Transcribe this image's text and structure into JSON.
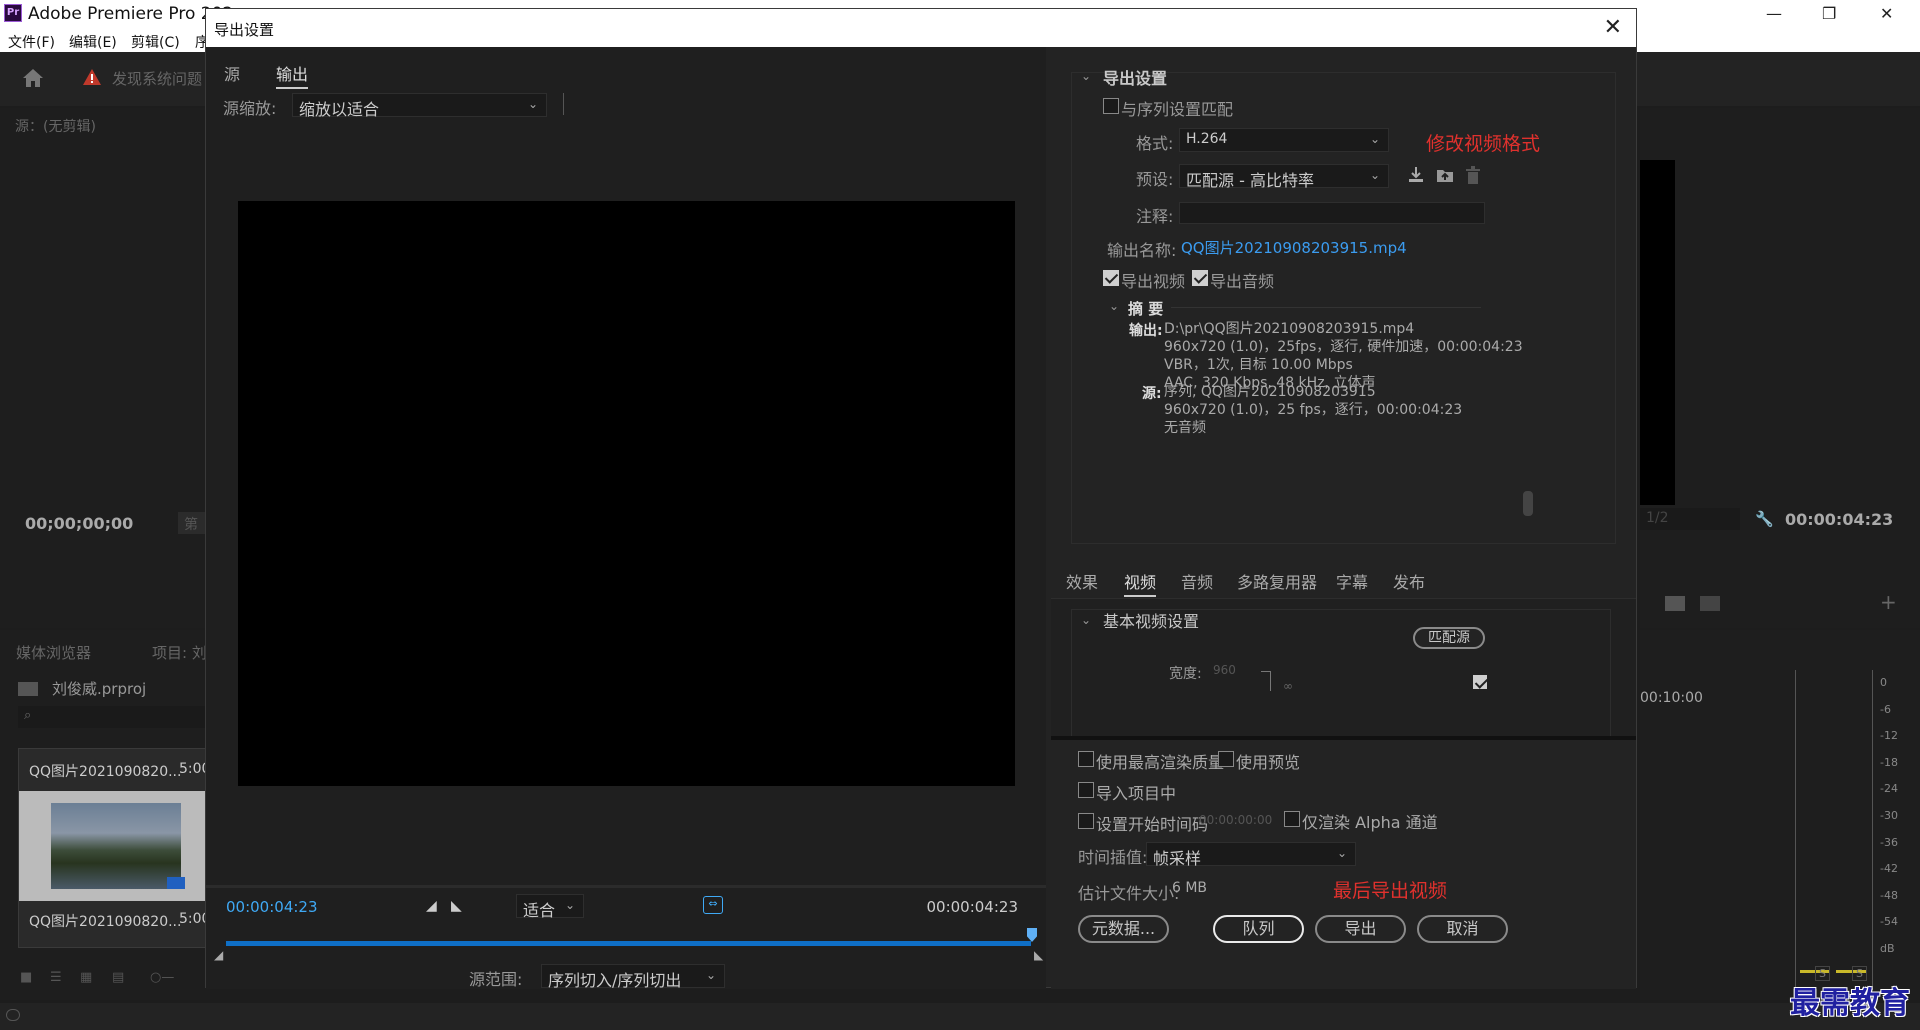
{
  "app": {
    "title": "Adobe Premiere Pro 202",
    "menu": [
      "文件(F)",
      "编辑(E)",
      "剪辑(C)",
      "序"
    ],
    "toolbar_warning": "发现系统问题"
  },
  "source_panel": {
    "title": "源：(无剪辑)",
    "timecode": "00;00;00;00",
    "badge": "第"
  },
  "project_panel": {
    "tabs": [
      "媒体浏览器",
      "项目: 刘"
    ],
    "project_name": "刘俊威.prproj",
    "clip_name": "QQ图片2021090820...",
    "clip_duration": "5:00",
    "clip_name_2": "QQ图片2021090820...",
    "clip_duration_2": "5:00"
  },
  "right_panel": {
    "fraction": "1/2",
    "timecode": "00:00:04:23",
    "timeline_time": "00:10:00",
    "meter_labels": [
      "0",
      "-6",
      "-12",
      "-18",
      "-24",
      "-30",
      "-36",
      "-42",
      "-48",
      "-54",
      "dB"
    ],
    "solo_labels": [
      "S",
      "S"
    ]
  },
  "dialog": {
    "title": "导出设置",
    "close": "✕",
    "preview": {
      "tabs": [
        "源",
        "输出"
      ],
      "active_tab": "输出",
      "zoom_label": "源缩放:",
      "zoom_value": "缩放以适合",
      "tc_in": "00:00:04:23",
      "tc_out": "00:00:04:23",
      "fit_value": "适合",
      "range_label": "源范围:",
      "range_value": "序列切入/序列切出"
    },
    "export_settings": {
      "section_title": "导出设置",
      "match_sequence_label": "与序列设置匹配",
      "match_sequence_checked": false,
      "format_label": "格式:",
      "format_value": "H.264",
      "format_note": "修改视频格式",
      "preset_label": "预设:",
      "preset_value": "匹配源 - 高比特率",
      "comments_label": "注释:",
      "comments_value": "",
      "output_name_label": "输出名称:",
      "output_name_value": "QQ图片20210908203915.mp4",
      "export_video_label": "导出视频",
      "export_video_checked": true,
      "export_audio_label": "导出音频",
      "export_audio_checked": true,
      "summary": {
        "title": "摘 要",
        "output_label": "输出:",
        "output_lines": [
          "D:\\pr\\QQ图片20210908203915.mp4",
          "960x720 (1.0)，25fps，逐行, 硬件加速，00:00:04:23",
          "VBR，1次, 目标 10.00 Mbps",
          "AAC, 320 Kbps, 48 kHz, 立体声"
        ],
        "source_label": "源:",
        "source_lines": [
          "序列, QQ图片20210908203915",
          "960x720 (1.0)，25 fps，逐行，00:00:04:23",
          "无音频"
        ]
      }
    },
    "sub_tabs": [
      "效果",
      "视频",
      "音频",
      "多路复用器",
      "字幕",
      "发布"
    ],
    "active_sub_tab": "视频",
    "video": {
      "section_title": "基本视频设置",
      "match_source_button": "匹配源",
      "width_label": "宽度:",
      "width_value": "960"
    },
    "options": {
      "max_render_quality": "使用最高渲染质量",
      "use_previews": "使用预览",
      "import_into_project": "导入项目中",
      "set_start_timecode": "设置开始时间码",
      "start_timecode_value": "00:00:00:00",
      "render_alpha_only": "仅渲染 Alpha 通道",
      "time_interpolation_label": "时间插值:",
      "time_interpolation_value": "帧采样",
      "file_size_label": "估计文件大小:",
      "file_size_value": "6 MB",
      "final_note": "最后导出视频"
    },
    "buttons": {
      "metadata": "元数据...",
      "queue": "队列",
      "export": "导出",
      "cancel": "取消"
    }
  },
  "watermark": "最需教育",
  "colors": {
    "accent_blue": "#3fa9f5",
    "annotation_red": "#e0312d",
    "dialog_bg": "#232323"
  }
}
